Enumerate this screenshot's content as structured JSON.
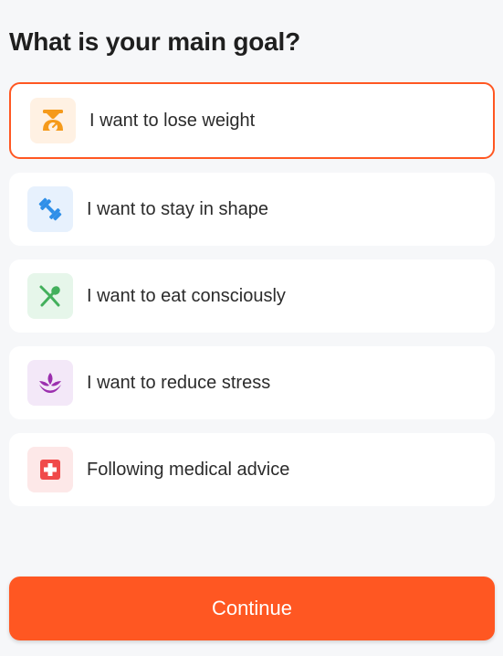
{
  "header": {
    "title": "What is your main goal?"
  },
  "options": [
    {
      "label": "I want to lose weight",
      "icon": "scale-icon",
      "selected": true,
      "icon_color": "#f59a1b"
    },
    {
      "label": "I want to stay in shape",
      "icon": "dumbbell-icon",
      "selected": false,
      "icon_color": "#2f8fe8"
    },
    {
      "label": "I want to eat consciously",
      "icon": "cutlery-icon",
      "selected": false,
      "icon_color": "#43b05c"
    },
    {
      "label": "I want to reduce stress",
      "icon": "lotus-icon",
      "selected": false,
      "icon_color": "#9b2fae"
    },
    {
      "label": "Following medical advice",
      "icon": "medical-cross-icon",
      "selected": false,
      "icon_color": "#f04a4a"
    }
  ],
  "footer": {
    "continue_label": "Continue"
  },
  "colors": {
    "accent": "#ff5722",
    "background": "#f6f7f9",
    "card": "#ffffff",
    "text": "#1f1f1f"
  }
}
